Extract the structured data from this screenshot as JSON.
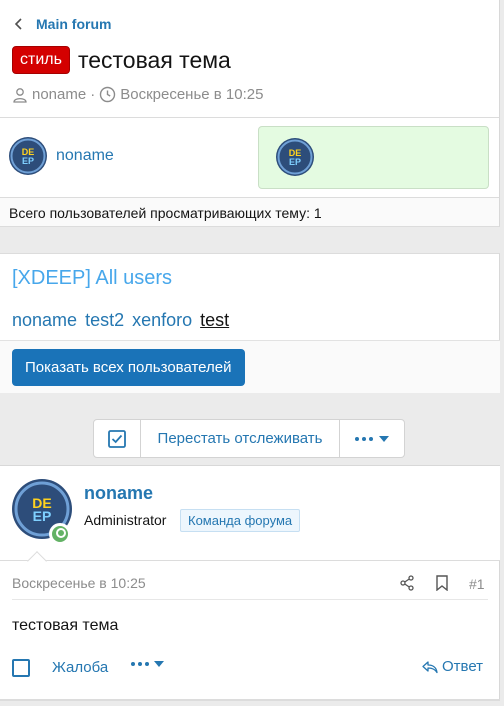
{
  "breadcrumb": {
    "label": "Main forum"
  },
  "thread": {
    "prefix": "стиль",
    "title": "тестовая тема",
    "author": "noname",
    "separator": "·",
    "date": "Воскресенье в 10:25"
  },
  "viewers": {
    "user": "noname",
    "count_text": "Всего пользователей просматривающих тему: 1"
  },
  "avatar_text": {
    "line1": "DE",
    "line2": "EP"
  },
  "xdeep": {
    "title": "[XDEEP] All users",
    "users": [
      "noname",
      "test2",
      "xenforo",
      "test"
    ],
    "show_all_button": "Показать всех пользователей"
  },
  "toolbar": {
    "unwatch_label": "Перестать отслеживать"
  },
  "post": {
    "username": "noname",
    "role": "Administrator",
    "badge": "Команда форума",
    "date": "Воскресенье в 10:25",
    "number": "#1",
    "body": "тестовая тема",
    "report_label": "Жалоба",
    "reply_label": "Ответ"
  },
  "colors": {
    "link": "#2577b1",
    "prefix_bg": "#d40000",
    "xdeep_title": "#47a7eb",
    "button_bg": "#1a73b8",
    "online": "#63b265",
    "highlight_bg": "#e4fbe1"
  },
  "icons": {
    "back": "chevron-left-icon",
    "author": "user-icon",
    "time": "clock-icon",
    "watch": "checkbox-checked-icon",
    "more": "ellipsis-icon",
    "share": "share-icon",
    "bookmark": "bookmark-icon",
    "reply": "reply-icon"
  }
}
